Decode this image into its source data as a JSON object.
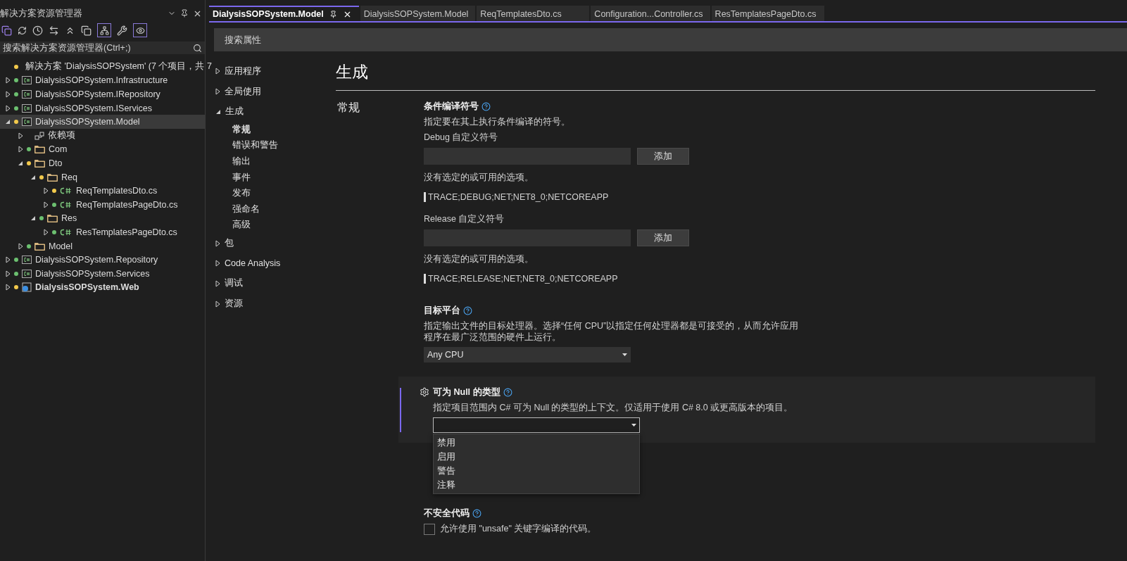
{
  "solution_explorer": {
    "title": "解决方案资源管理器",
    "search": {
      "placeholder": "搜索解决方案资源管理器(Ctrl+;)"
    },
    "tree": [
      {
        "kind": "solution",
        "label": "解决方案 'DialysisSOPSystem' (7 个项目，共 7",
        "modified": true,
        "selected": false,
        "bold": false
      },
      {
        "kind": "project",
        "label": "DialysisSOPSystem.Infrastructure",
        "modified": false,
        "expanded": false,
        "selected": false,
        "bold": false
      },
      {
        "kind": "project",
        "label": "DialysisSOPSystem.IRepository",
        "modified": false,
        "expanded": false,
        "selected": false,
        "bold": false
      },
      {
        "kind": "project",
        "label": "DialysisSOPSystem.IServices",
        "modified": false,
        "expanded": false,
        "selected": false,
        "bold": false
      },
      {
        "kind": "project",
        "label": "DialysisSOPSystem.Model",
        "modified": true,
        "expanded": true,
        "selected": true,
        "bold": false,
        "children": [
          {
            "kind": "deps",
            "label": "依赖项",
            "expanded": false,
            "selected": false
          },
          {
            "kind": "folder",
            "label": "Com",
            "modified": false,
            "expanded": false,
            "selected": false
          },
          {
            "kind": "folder",
            "label": "Dto",
            "modified": true,
            "expanded": true,
            "selected": false,
            "children": [
              {
                "kind": "folder",
                "label": "Req",
                "modified": true,
                "expanded": true,
                "selected": false,
                "children": [
                  {
                    "kind": "file",
                    "label": "ReqTemplatesDto.cs",
                    "modified": true,
                    "expanded": false,
                    "selected": false
                  },
                  {
                    "kind": "file",
                    "label": "ReqTemplatesPageDto.cs",
                    "modified": false,
                    "expanded": false,
                    "selected": false
                  }
                ]
              },
              {
                "kind": "folder",
                "label": "Res",
                "modified": false,
                "expanded": true,
                "selected": false,
                "children": [
                  {
                    "kind": "file",
                    "label": "ResTemplatesPageDto.cs",
                    "modified": false,
                    "expanded": false,
                    "selected": false
                  }
                ]
              }
            ]
          },
          {
            "kind": "folder",
            "label": "Model",
            "modified": false,
            "expanded": false,
            "selected": false
          }
        ]
      },
      {
        "kind": "project",
        "label": "DialysisSOPSystem.Repository",
        "modified": false,
        "expanded": false,
        "selected": false,
        "bold": false
      },
      {
        "kind": "project",
        "label": "DialysisSOPSystem.Services",
        "modified": false,
        "expanded": false,
        "selected": false,
        "bold": false
      },
      {
        "kind": "web",
        "label": "DialysisSOPSystem.Web",
        "modified": true,
        "expanded": false,
        "selected": false,
        "bold": true
      }
    ]
  },
  "tabs": [
    {
      "label": "DialysisSOPSystem.Model",
      "selected": true
    },
    {
      "label": "DialysisSOPSystem.Model",
      "selected": false
    },
    {
      "label": "ReqTemplatesDto.cs",
      "selected": false
    },
    {
      "label": "Configuration...Controller.cs",
      "selected": false
    },
    {
      "label": "ResTemplatesPageDto.cs",
      "selected": false
    }
  ],
  "property_search": {
    "placeholder": "搜索属性"
  },
  "nav": [
    {
      "label": "应用程序",
      "expanded": false,
      "selected": false
    },
    {
      "label": "全局使用",
      "expanded": false,
      "selected": false
    },
    {
      "label": "生成",
      "expanded": true,
      "selected": false,
      "children": [
        {
          "label": "常规",
          "selected": true
        },
        {
          "label": "错误和警告",
          "selected": false
        },
        {
          "label": "输出",
          "selected": false
        },
        {
          "label": "事件",
          "selected": false
        },
        {
          "label": "发布",
          "selected": false
        },
        {
          "label": "强命名",
          "selected": false
        },
        {
          "label": "高级",
          "selected": false
        }
      ]
    },
    {
      "label": "包",
      "expanded": false,
      "selected": false
    },
    {
      "label": "Code Analysis",
      "expanded": false,
      "selected": false
    },
    {
      "label": "调试",
      "expanded": false,
      "selected": false
    },
    {
      "label": "资源",
      "expanded": false,
      "selected": false
    }
  ],
  "page_title": "生成",
  "section_title": "常规",
  "settings": [
    {
      "kind": "symbols",
      "title": "条件编译符号",
      "description": "指定要在其上执行条件编译的符号。",
      "highlighted": false,
      "groups": [
        {
          "heading": "Debug 自定义符号",
          "button": "添加",
          "note": "没有选定的或可用的选项。",
          "defined_symbols": "TRACE;DEBUG;NET;NET8_0;NETCOREAPP"
        },
        {
          "heading": "Release 自定义符号",
          "button": "添加",
          "note": "没有选定的或可用的选项。",
          "defined_symbols": "TRACE;RELEASE;NET;NET8_0;NETCOREAPP"
        }
      ]
    },
    {
      "kind": "dropdown",
      "title": "目标平台",
      "description": "指定输出文件的目标处理器。选择“任何 CPU”以指定任何处理器都是可接受的，从而允许应用程序在最广泛范围的硬件上运行。",
      "value": "Any CPU",
      "highlighted": false,
      "open": false
    },
    {
      "kind": "dropdown",
      "title": "可为 Null 的类型",
      "description": "指定项目范围内 C# 可为 Null 的类型的上下文。仅适用于使用 C# 8.0 或更高版本的项目。",
      "highlighted": true,
      "open": true,
      "options": [
        "禁用",
        "启用",
        "警告",
        "注释"
      ]
    },
    {
      "kind": "checkbox",
      "title": "不安全代码",
      "label": "允许使用 \"unsafe\" 关键字编译的代码。",
      "checked": false,
      "highlighted": false
    }
  ]
}
